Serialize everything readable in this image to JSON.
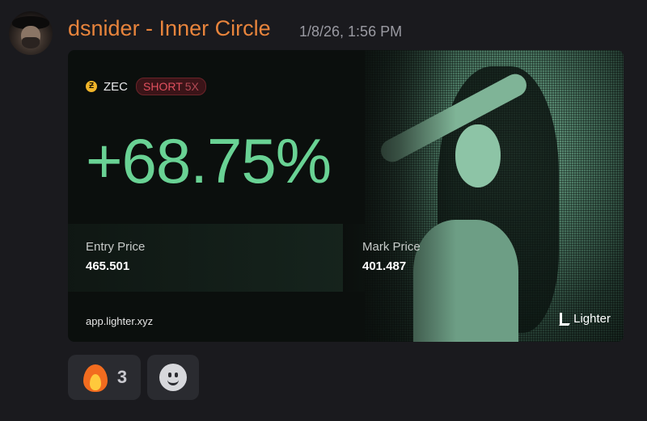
{
  "message": {
    "username": "dsnider - Inner Circle",
    "timestamp": "1/8/26, 1:56 PM",
    "username_color": "#e8843c"
  },
  "card": {
    "token": "ZEC",
    "side": "SHORT",
    "leverage": "5X",
    "pnl_percent": "+68.75%",
    "entry_label": "Entry Price",
    "entry_value": "465.501",
    "mark_label": "Mark Price",
    "mark_value": "401.487",
    "site": "app.lighter.xyz",
    "brand": "Lighter",
    "pnl_color": "#69d294",
    "short_color": "#e0505e"
  },
  "reactions": [
    {
      "emoji": "fire",
      "count": "3"
    },
    {
      "emoji": "add-reaction"
    }
  ]
}
